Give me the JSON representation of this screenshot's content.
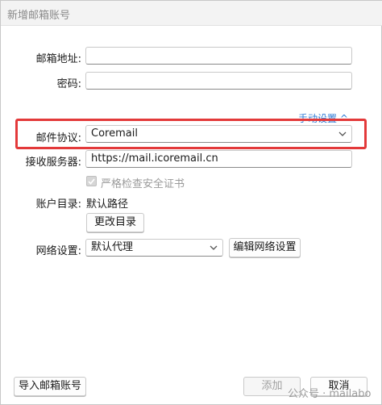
{
  "window": {
    "title": "新增邮箱账号"
  },
  "form": {
    "email_label": "邮箱地址:",
    "email_value": "",
    "password_label": "密码:",
    "password_value": "",
    "manual_setup_link": "手动设置 ^",
    "protocol_label": "邮件协议:",
    "protocol_value": "Coremail",
    "server_label": "接收服务器:",
    "server_value": "https://mail.icoremail.cn",
    "strict_check_label": "严格检查安全证书",
    "strict_check_checked": true,
    "account_dir_label": "账户目录:",
    "account_dir_value": "默认路径",
    "change_dir_button": "更改目录",
    "network_label": "网络设置:",
    "network_value": "默认代理",
    "edit_network_button": "编辑网络设置"
  },
  "footer": {
    "import_button": "导入邮箱账号",
    "add_button": "添加",
    "cancel_button": "取消",
    "watermark": "公众号 · mailabo"
  },
  "colors": {
    "highlight": "#e3393a",
    "link": "#2e7bd6"
  }
}
